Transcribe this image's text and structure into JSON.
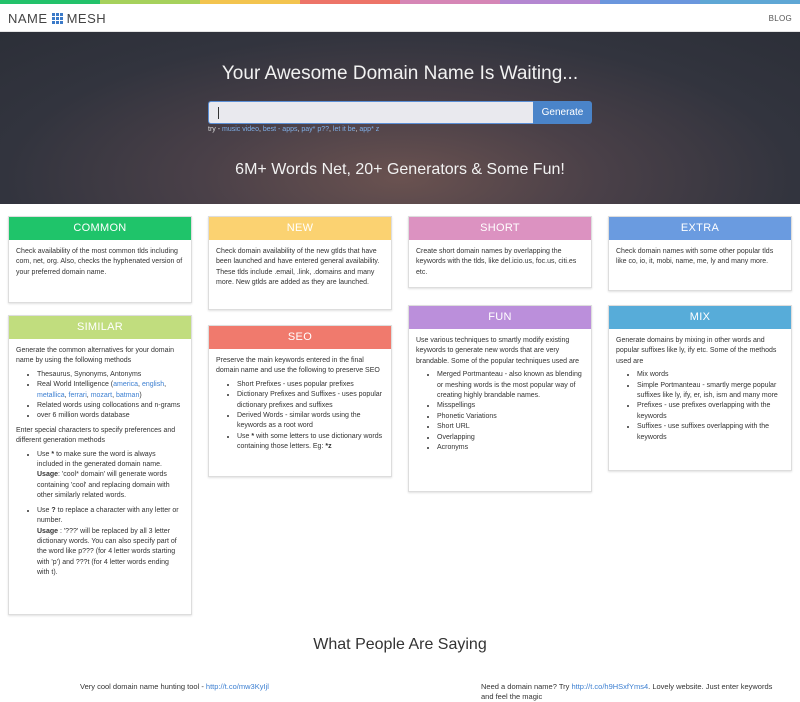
{
  "brand": {
    "colors": [
      "#23c26b",
      "#a6d15c",
      "#f3c44f",
      "#ed7468",
      "#d686b6",
      "#b487d1",
      "#6b96dd",
      "#5fa7d5"
    ],
    "logo_left": "NAME",
    "logo_right": "MESH",
    "logo_icon": "grid-icon"
  },
  "nav": {
    "blog": "BLOG"
  },
  "hero": {
    "title": "Your Awesome Domain Name Is Waiting...",
    "search_value": "",
    "generate": "Generate",
    "try_prefix": "try - ",
    "try_links": [
      "music video",
      "best - apps",
      "pay* p??",
      "let it be",
      "app* z"
    ],
    "tagline": "6M+ Words Net, 20+ Generators & Some Fun!"
  },
  "cards": {
    "common": {
      "title": "COMMON",
      "color": "#1fc46a",
      "text": "Check availability of the most common tlds including com, net, org. Also, checks the hyphenated version of your preferred domain name."
    },
    "new": {
      "title": "NEW",
      "color": "#fbd271",
      "text": "Check domain availability of the new gtlds that have been launched and have entered general availability. These tlds include .email, .link, .domains and many more. New gtlds are added as they are launched."
    },
    "short": {
      "title": "SHORT",
      "color": "#dc92c1",
      "text": "Create short domain names by overlapping the keywords with the tlds, like del.icio.us, foc.us, citi.es etc."
    },
    "extra": {
      "title": "EXTRA",
      "color": "#6a9be0",
      "text": "Check domain names with some other popular tlds like co, io, it, mobi, name, me, ly and many more."
    },
    "similar": {
      "title": "SIMILAR",
      "color": "#c1dd7e",
      "intro": "Generate the common alternatives for your domain name by using the following methods",
      "list1_a": "Thesaurus, Synonyms, Antonyms",
      "list1_b_prefix": "Real World Intelligence (",
      "rw_links": [
        "america",
        "english",
        "metallica",
        "ferrari",
        "mozart",
        "batman"
      ],
      "list1_b_suffix": ")",
      "list1_c": "Related words using collocations and n-grams",
      "list1_d": "over 6 million words database",
      "intro2": "Enter special characters to specify preferences and different generation methods",
      "star_a": "Use ",
      "star_sym": "*",
      "star_b": " to make sure the word is always included in the generated domain name.",
      "usage_label": "Usage",
      "star_usage": ": 'cool* domain' will generate words containing 'cool' and replacing domain with other similarly related words.",
      "q_a": "Use ",
      "q_sym": "?",
      "q_b": " to replace a character with any letter or number.",
      "q_usage": " : '???' will be replaced by all 3 letter dictionary words. You can also specify part of the word like p??? (for 4 letter words starting with 'p') and ???t (for 4 letter words ending with t)."
    },
    "seo": {
      "title": "SEO",
      "color": "#f07a6d",
      "intro": "Preserve the main keywords entered in the final domain name and use the following to preserve SEO",
      "items": [
        "Short Prefixes - uses popular prefixes",
        "Dictionary Prefixes and Suffixes - uses popular dictionary prefixes and suffixes",
        "Derived Words - similar words using the keywords as a root word"
      ],
      "last_a": "Use ",
      "last_sym": "*",
      "last_b": " with some letters to use dictionary words containing those letters. Eg: ",
      "last_eg": "*z"
    },
    "fun": {
      "title": "FUN",
      "color": "#bb8fdb",
      "intro": "Use various techniques to smartly modify existing keywords to generate new words that are very brandable. Some of the popular techniques used are",
      "items": [
        "Merged Portmanteau - also known as blending or meshing words is the most popular way of creating highly brandable names.",
        "Misspellings",
        "Phonetic Variations",
        "Short URL",
        "Overlapping",
        "Acronyms"
      ]
    },
    "mix": {
      "title": "MIX",
      "color": "#57acd9",
      "intro": "Generate domains by mixing in other words and popular suffixes like ly, ify etc. Some of the methods used are",
      "items": [
        "Mix words",
        "Simple Portmanteau - smartly merge popular suffixes like ly, ify, er, ish, ism and many more",
        "Prefixes - use prefixes overlapping with the keywords",
        "Suffixes - use suffixes overlapping with the keywords"
      ]
    }
  },
  "testimonials": {
    "title": "What People Are Saying",
    "t1_text": "Very cool domain name hunting tool - ",
    "t1_link": "http://t.co/mw3KyIjl",
    "t2_text": "Need a domain name? Try ",
    "t2_link": "http://t.co/h9HSxfYms4",
    "t2_rest": ". Lovely website. Just enter keywords and feel the magic"
  }
}
